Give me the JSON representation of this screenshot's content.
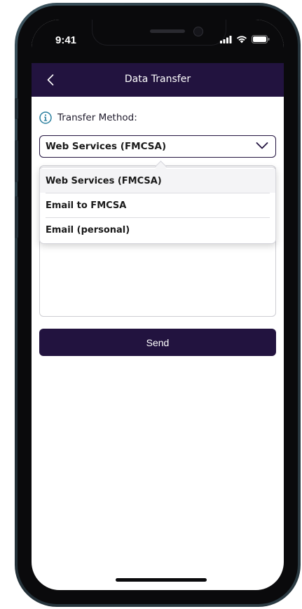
{
  "status": {
    "time": "9:41"
  },
  "nav": {
    "title": "Data Transfer",
    "back_icon": "chevron-left-icon"
  },
  "form": {
    "method_label": "Transfer Method:",
    "info_icon": "info-icon",
    "selected_value": "Web Services (FMCSA)",
    "chevron_icon": "chevron-down-icon",
    "options": [
      "Web Services (FMCSA)",
      "Email to FMCSA",
      "Email (personal)"
    ]
  },
  "actions": {
    "send_label": "Send"
  },
  "colors": {
    "brand": "#22133f",
    "info_accent": "#2a7f9e"
  }
}
